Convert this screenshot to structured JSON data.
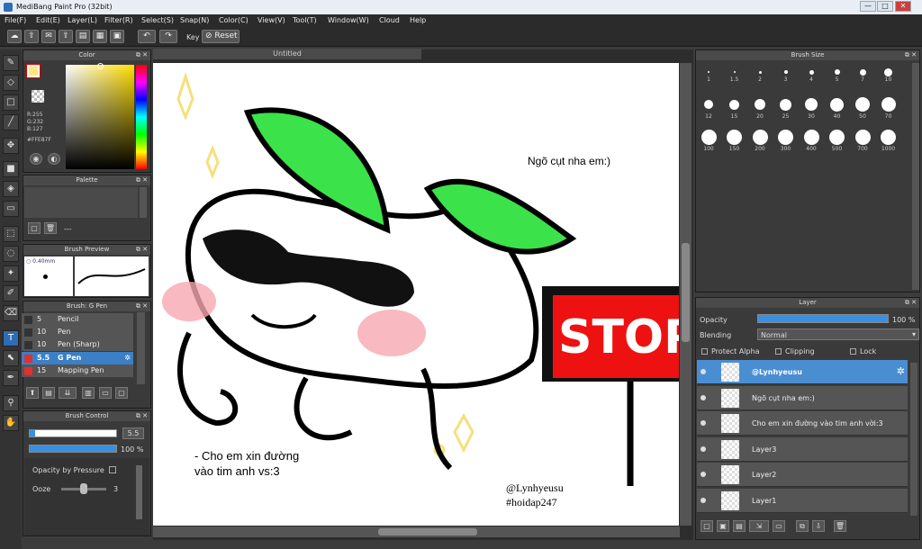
{
  "window": {
    "title": "MediBang Paint Pro (32bit)",
    "controls": [
      "—",
      "□",
      "✕"
    ]
  },
  "menu": [
    "File(F)",
    "Edit(E)",
    "Layer(L)",
    "Filter(R)",
    "Select(S)",
    "Snap(N)",
    "Color(C)",
    "View(V)",
    "Tool(T)",
    "Window(W)",
    "Cloud",
    "Help"
  ],
  "toolbar": {
    "key_label": "Key",
    "reset_label": "Reset"
  },
  "color_panel": {
    "title": "Color",
    "r": "R:255",
    "g": "G:232",
    "b": "B:127",
    "hex": "#FFE87F",
    "fg": "#ffe87f"
  },
  "palette_panel": {
    "title": "Palette",
    "dashes": "---"
  },
  "brush_preview": {
    "title": "Brush Preview",
    "size": "0.40mm"
  },
  "brush_panel": {
    "title": "Brush: G Pen",
    "items": [
      {
        "size": "5",
        "name": "Pencil",
        "color": "#333333"
      },
      {
        "size": "10",
        "name": "Pen",
        "color": "#333333"
      },
      {
        "size": "10",
        "name": "Pen (Sharp)",
        "color": "#333333"
      },
      {
        "size": "5.5",
        "name": "G Pen",
        "color": "#e03030"
      },
      {
        "size": "15",
        "name": "Mapping Pen",
        "color": "#e03030"
      }
    ]
  },
  "brush_control": {
    "title": "Brush Control",
    "size_value": "5.5",
    "opacity_value": "100 %",
    "opacity_by_pressure": "Opacity by Pressure",
    "ooze_label": "Ooze",
    "ooze_value": "3",
    "ooze_level": 0.3
  },
  "canvas_tab": {
    "title": "Untitled"
  },
  "canvas_texts": {
    "top_right": "Ngõ cụt nha em:)",
    "bottom_left": "- Cho em xin đường\nvào tim anh vs:3",
    "signature": "@Lynhyeusu\n#hoidap247",
    "stop": "STOP"
  },
  "brush_size_panel": {
    "title": "Brush Size",
    "sizes": [
      "1",
      "1.5",
      "2",
      "3",
      "4",
      "5",
      "7",
      "10",
      "12",
      "15",
      "20",
      "25",
      "30",
      "40",
      "50",
      "70",
      "100",
      "150",
      "200",
      "300",
      "400",
      "500",
      "700",
      "1000"
    ]
  },
  "layer_panel": {
    "title": "Layer",
    "opacity_label": "Opacity",
    "opacity_value": "100 %",
    "opacity_level": 1.0,
    "blending_label": "Blending",
    "blending_value": "Normal",
    "protect_alpha": "Protect Alpha",
    "clipping": "Clipping",
    "lock": "Lock",
    "layers": [
      "@Lynhyeusu",
      "Ngõ cụt nha em:)",
      "Cho em xin đường vào tim anh vời:3",
      "Layer3",
      "Layer2",
      "Layer1"
    ]
  }
}
